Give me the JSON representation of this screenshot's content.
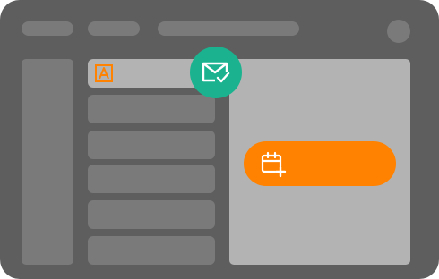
{
  "header": {
    "nav_items": [
      {
        "icon": "placeholder-bar"
      },
      {
        "icon": "placeholder-bar"
      },
      {
        "icon": "placeholder-bar"
      }
    ],
    "avatar": "user-avatar"
  },
  "list": {
    "items": [
      {
        "icon": "text-format-icon",
        "selected": true
      },
      {
        "selected": false
      },
      {
        "selected": false
      },
      {
        "selected": false
      },
      {
        "selected": false
      },
      {
        "selected": false
      }
    ]
  },
  "badges": {
    "mail": {
      "icon": "mail-check-icon",
      "color": "#1bb38f"
    }
  },
  "cta": {
    "icon": "calendar-add-icon",
    "label": "",
    "color": "#ff8200"
  },
  "colors": {
    "window": "#5e5e5e",
    "placeholder": "#7a7a7a",
    "selected": "#b3b3b3",
    "accent_orange": "#ff8200",
    "accent_green": "#1bb38f"
  }
}
